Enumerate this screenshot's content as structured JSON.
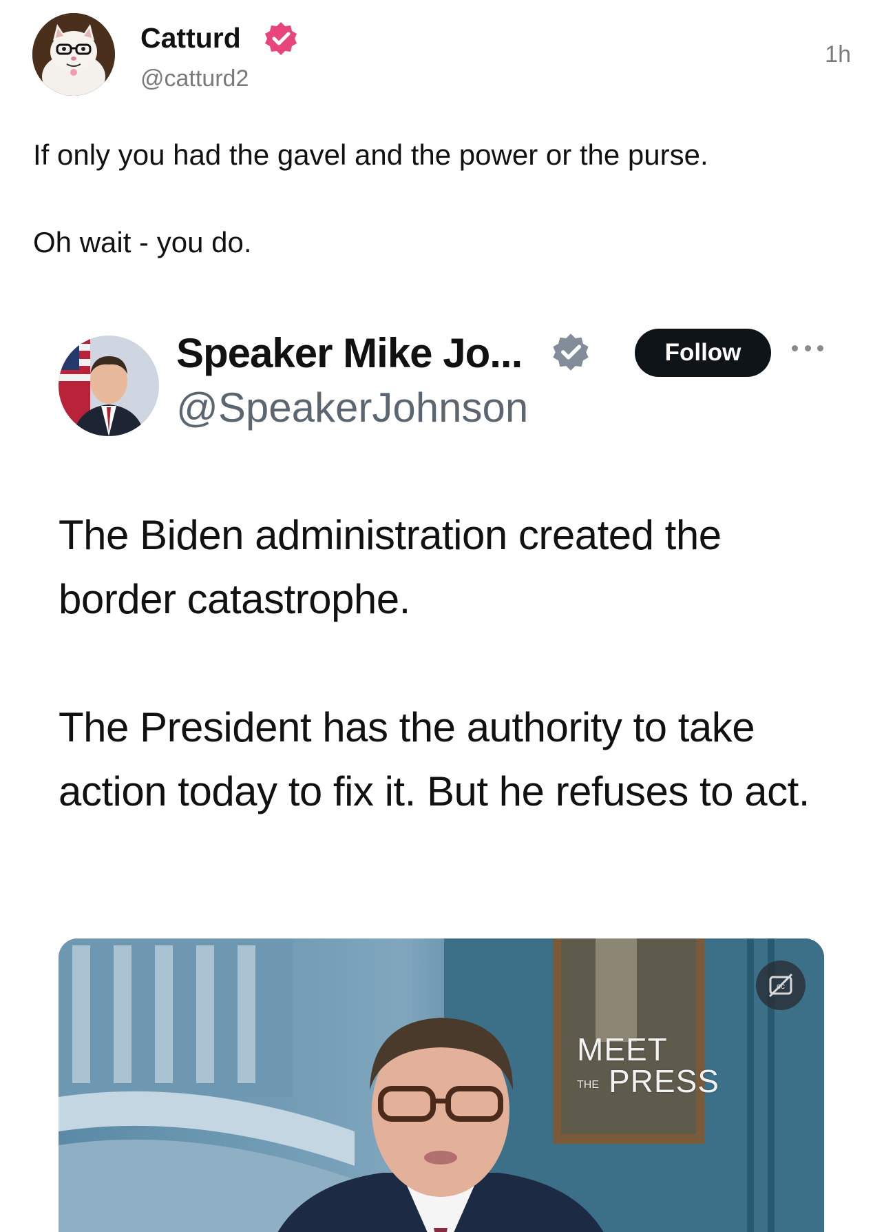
{
  "post": {
    "author_name": "Catturd",
    "author_handle": "@catturd2",
    "timestamp": "1h",
    "text_line_1": "If only you had the gavel and the power or the purse.",
    "text_line_2": "Oh wait - you do.",
    "verified_badge_color": "#e8457a"
  },
  "embedded_tweet": {
    "author_name": "Speaker Mike Jo...",
    "author_handle": "@SpeakerJohnson",
    "follow_label": "Follow",
    "paragraph_1": "The Biden administration created the border catastrophe.",
    "paragraph_2": "The President has the authority to take action today to fix it. But he refuses to act.",
    "verified_badge_color": "#828d99",
    "video": {
      "logo_line_1": "MEET",
      "logo_small": "THE",
      "logo_line_2": "PRESS",
      "captions_icon": "captions-off-icon"
    }
  }
}
